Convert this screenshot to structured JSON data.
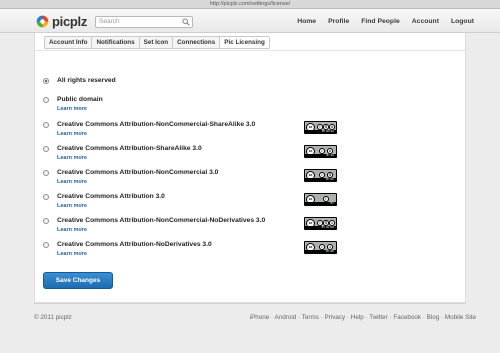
{
  "browser": {
    "url": "http://picplz.com/settings/license/"
  },
  "header": {
    "logo_text": "picplz",
    "search_placeholder": "Search",
    "nav": [
      "Home",
      "Profile",
      "Find People",
      "Account",
      "Logout"
    ]
  },
  "tabs": [
    {
      "label": "Account Info",
      "active": false
    },
    {
      "label": "Notifications",
      "active": false
    },
    {
      "label": "Set Icon",
      "active": false
    },
    {
      "label": "Connections",
      "active": false
    },
    {
      "label": "Pic Licensing",
      "active": true
    }
  ],
  "licenses": [
    {
      "label": "All rights reserved",
      "learn_more": "",
      "selected": true,
      "badge": null
    },
    {
      "label": "Public domain",
      "learn_more": "Learn more",
      "selected": false,
      "badge": null
    },
    {
      "label": "Creative Commons Attribution-NonCommercial-ShareAlike 3.0",
      "learn_more": "Learn more",
      "selected": false,
      "badge": "BY NC SA"
    },
    {
      "label": "Creative Commons Attribution-ShareAlike 3.0",
      "learn_more": "Learn more",
      "selected": false,
      "badge": "BY SA"
    },
    {
      "label": "Creative Commons Attribution-NonCommercial 3.0",
      "learn_more": "Learn more",
      "selected": false,
      "badge": "BY NC"
    },
    {
      "label": "Creative Commons Attribution 3.0",
      "learn_more": "Learn more",
      "selected": false,
      "badge": "BY"
    },
    {
      "label": "Creative Commons Attribution-NonCommercial-NoDerivatives 3.0",
      "learn_more": "Learn more",
      "selected": false,
      "badge": "BY NC ND"
    },
    {
      "label": "Creative Commons Attribution-NoDerivatives 3.0",
      "learn_more": "Learn more",
      "selected": false,
      "badge": "BY ND"
    }
  ],
  "save_label": "Save Changes",
  "footer": {
    "copyright": "© 2011 picplz",
    "links": [
      "iPhone",
      "Android",
      "Terms",
      "Privacy",
      "Help",
      "Twitter",
      "Facebook",
      "Blog",
      "Mobile Site"
    ]
  },
  "colors": {
    "accent": "#1e6bb0",
    "link": "#1f5f9e"
  }
}
